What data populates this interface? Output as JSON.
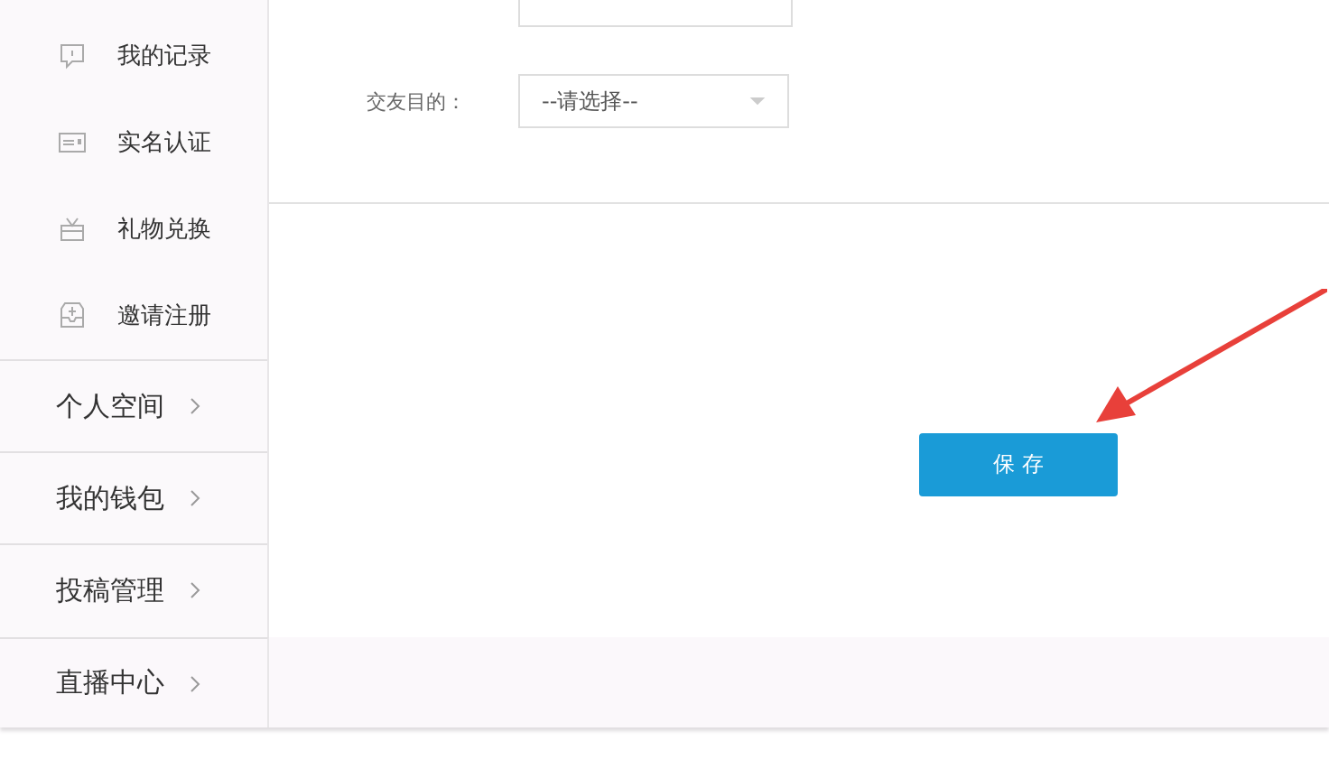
{
  "sidebar": {
    "sub_items": [
      {
        "label": "我的记录"
      },
      {
        "label": "实名认证"
      },
      {
        "label": "礼物兑换"
      },
      {
        "label": "邀请注册"
      }
    ],
    "sections": [
      {
        "label": "个人空间"
      },
      {
        "label": "我的钱包"
      },
      {
        "label": "投稿管理"
      },
      {
        "label": "直播中心"
      }
    ]
  },
  "form": {
    "fields": [
      {
        "label": "交友目的：",
        "placeholder": "--请选择--"
      }
    ],
    "save_button": "保 存"
  }
}
